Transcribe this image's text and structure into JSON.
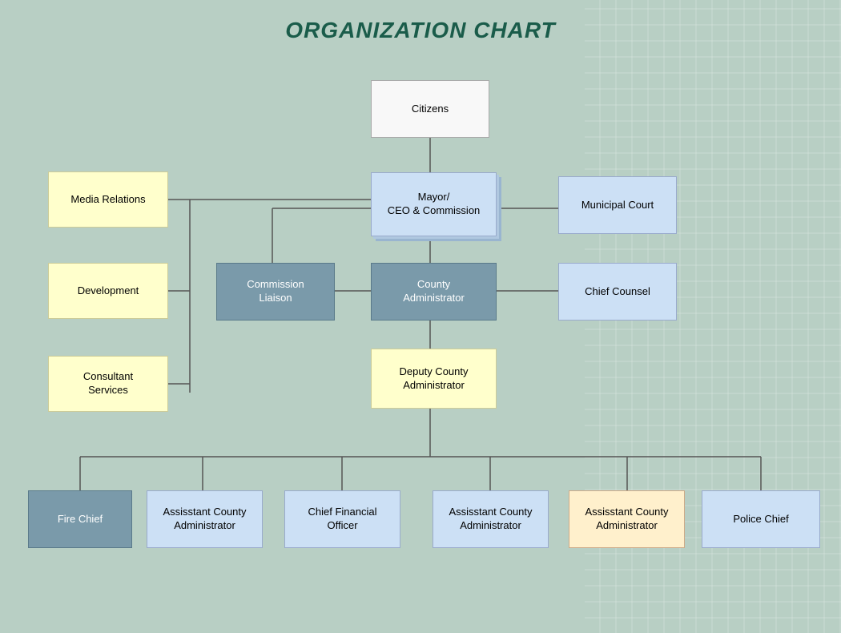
{
  "title": "ORGANIZATION CHART",
  "nodes": {
    "citizens": {
      "label": "Citizens"
    },
    "mayor": {
      "label": "Mayor/\nCEO & Commission"
    },
    "municipal_court": {
      "label": "Municipal Court"
    },
    "media_relations": {
      "label": "Media Relations"
    },
    "development": {
      "label": "Development"
    },
    "consultant_services": {
      "label": "Consultant\nServices"
    },
    "commission_liaison": {
      "label": "Commission\nLiaison"
    },
    "county_administrator": {
      "label": "County\nAdministrator"
    },
    "chief_counsel": {
      "label": "Chief Counsel"
    },
    "deputy_county_admin": {
      "label": "Deputy County\nAdministrator"
    },
    "fire_chief": {
      "label": "Fire Chief"
    },
    "asst_admin_1": {
      "label": "Assisstant County\nAdministrator"
    },
    "cfo": {
      "label": "Chief Financial\nOfficer"
    },
    "asst_admin_2": {
      "label": "Assisstant County\nAdministrator"
    },
    "asst_admin_3": {
      "label": "Assisstant County\nAdministrator"
    },
    "police_chief": {
      "label": "Police Chief"
    }
  }
}
